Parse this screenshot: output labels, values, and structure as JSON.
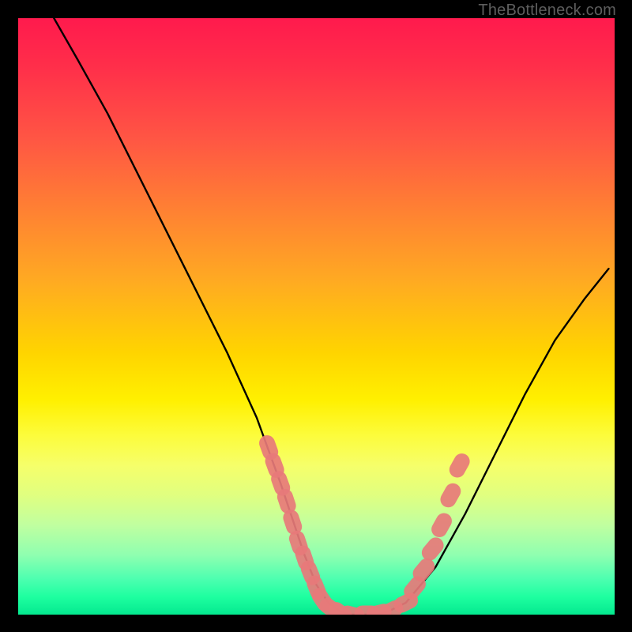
{
  "watermark": "TheBottleneck.com",
  "chart_data": {
    "type": "line",
    "title": "",
    "xlabel": "",
    "ylabel": "",
    "xlim": [
      0,
      100
    ],
    "ylim": [
      0,
      100
    ],
    "grid": false,
    "legend": false,
    "series": [
      {
        "name": "curve",
        "color": "#000000",
        "x": [
          6,
          10,
          15,
          20,
          25,
          30,
          35,
          40,
          44,
          46,
          48,
          50,
          52,
          54,
          56,
          58,
          60,
          62,
          65,
          70,
          75,
          80,
          85,
          90,
          95,
          99
        ],
        "y": [
          100,
          93,
          84,
          74,
          64,
          54,
          44,
          33,
          22,
          16,
          10,
          5,
          2,
          0.5,
          0,
          0,
          0,
          0.5,
          2,
          8,
          17,
          27,
          37,
          46,
          53,
          58
        ]
      }
    ],
    "markers": [
      {
        "name": "left-cluster",
        "color": "#e77a7a",
        "shape": "capsule",
        "points": [
          {
            "x": 42.0,
            "y": 28.0
          },
          {
            "x": 43.0,
            "y": 25.0
          },
          {
            "x": 44.0,
            "y": 22.0
          },
          {
            "x": 45.0,
            "y": 19.0
          },
          {
            "x": 46.0,
            "y": 15.5
          },
          {
            "x": 47.0,
            "y": 12.0
          },
          {
            "x": 48.0,
            "y": 9.5
          },
          {
            "x": 49.0,
            "y": 7.0
          },
          {
            "x": 50.0,
            "y": 4.5
          },
          {
            "x": 51.0,
            "y": 2.5
          }
        ]
      },
      {
        "name": "bottom-cluster",
        "color": "#e77a7a",
        "shape": "capsule",
        "points": [
          {
            "x": 52.5,
            "y": 1.0
          },
          {
            "x": 54.0,
            "y": 0.3
          },
          {
            "x": 56.0,
            "y": 0.0
          },
          {
            "x": 58.5,
            "y": 0.2
          },
          {
            "x": 60.5,
            "y": 0.3
          },
          {
            "x": 62.5,
            "y": 0.7
          }
        ]
      },
      {
        "name": "right-cluster",
        "color": "#e77a7a",
        "shape": "capsule",
        "points": [
          {
            "x": 65.0,
            "y": 2.0
          },
          {
            "x": 66.5,
            "y": 4.5
          },
          {
            "x": 68.0,
            "y": 7.5
          },
          {
            "x": 69.5,
            "y": 11.0
          },
          {
            "x": 71.0,
            "y": 15.0
          },
          {
            "x": 72.5,
            "y": 20.0
          },
          {
            "x": 74.0,
            "y": 25.0
          }
        ]
      }
    ]
  }
}
